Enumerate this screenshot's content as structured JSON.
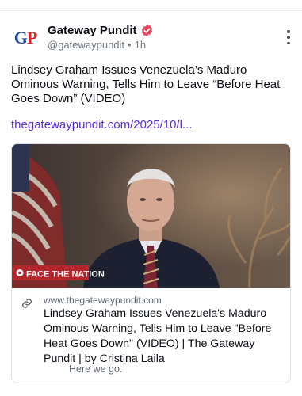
{
  "post": {
    "author": {
      "avatar_text_g": "G",
      "avatar_text_p": "P",
      "display_name": "Gateway Pundit",
      "handle": "@gatewaypundit",
      "separator": "•",
      "time": "1h",
      "verified_color": "#e8455b"
    },
    "text": "Lindsey Graham Issues Venezuela’s Maduro Ominous Warning, Tells Him to Leave “Before Heat Goes Down” (VIDEO)",
    "link_text": "thegatewaypundit.com/2025/10/l...",
    "embed": {
      "image_caption": "FACE THE NATION",
      "domain": "www.thegatewaypundit.com",
      "title": "Lindsey Graham Issues Venezuela's Maduro Ominous Warning, Tells Him to Leave \"Before Heat Goes Down\" (VIDEO) | The Gateway Pundit | by Cristina Laila",
      "description": "Here we go."
    }
  },
  "colors": {
    "link": "#5a2bd4",
    "brand_blue": "#1f4aa8",
    "brand_red": "#d8262b"
  }
}
